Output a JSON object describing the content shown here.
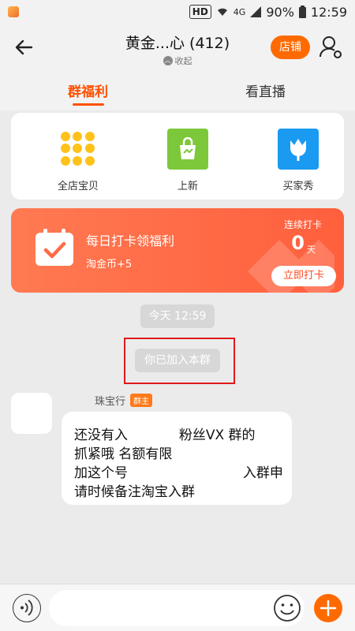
{
  "status_bar": {
    "network": "HD",
    "signal": "4G",
    "battery": "90%",
    "time": "12:59"
  },
  "header": {
    "title": "黄金...心 (412)",
    "collapse_label": "收起",
    "shop_label": "店铺"
  },
  "tabs": [
    {
      "label": "群福利"
    },
    {
      "label": "看直播"
    }
  ],
  "quick_links": [
    {
      "label": "全店宝贝"
    },
    {
      "label": "上新"
    },
    {
      "label": "买家秀"
    }
  ],
  "checkin": {
    "title": "每日打卡领福利",
    "reward": "淘金币+5",
    "streak_label": "连续打卡",
    "streak_count": "0",
    "streak_unit": "天",
    "button": "立即打卡"
  },
  "chat": {
    "timestamp": "今天 12:59",
    "system_message": "你已加入本群",
    "message": {
      "sender": "珠宝行",
      "badge": "群主",
      "lines": [
        "还没有入            粉丝VX 群的",
        "抓紧哦 名额有限",
        "加这个号                           入群申",
        "请时候备注淘宝入群"
      ]
    }
  },
  "colors": {
    "accent": "#ff6a00",
    "tab_active": "#ff5000",
    "checkin": "#ff6a45"
  }
}
